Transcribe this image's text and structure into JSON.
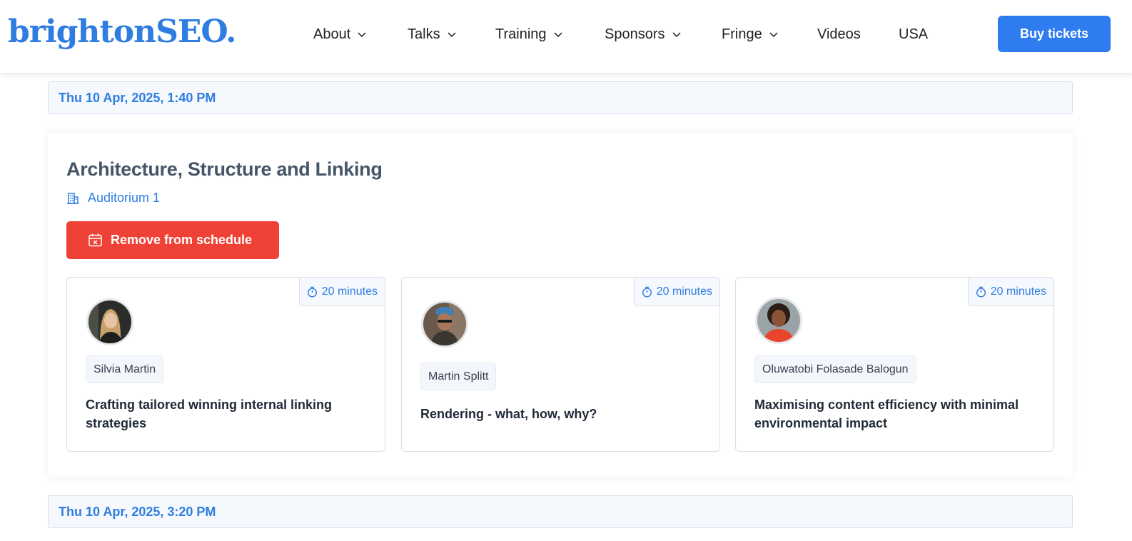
{
  "header": {
    "logo": "brightonSEO.",
    "nav": [
      {
        "label": "About",
        "dropdown": true
      },
      {
        "label": "Talks",
        "dropdown": true
      },
      {
        "label": "Training",
        "dropdown": true
      },
      {
        "label": "Sponsors",
        "dropdown": true
      },
      {
        "label": "Fringe",
        "dropdown": true
      },
      {
        "label": "Videos",
        "dropdown": false
      },
      {
        "label": "USA",
        "dropdown": false
      }
    ],
    "buy_label": "Buy tickets"
  },
  "timeslots": [
    {
      "label": "Thu 10 Apr, 2025, 1:40 PM"
    },
    {
      "label": "Thu 10 Apr, 2025, 3:20 PM"
    }
  ],
  "session": {
    "title": "Architecture, Structure and Linking",
    "room": "Auditorium 1",
    "room_icon": "building-icon",
    "remove_label": "Remove from schedule",
    "remove_icon": "calendar-x-icon",
    "talks": [
      {
        "duration": "20 minutes",
        "speaker": "Silvia Martin",
        "title_lines": [
          "Crafting tailored winning internal linking",
          "strategies"
        ]
      },
      {
        "duration": "20 minutes",
        "speaker": "Martin Splitt",
        "title_lines": [
          "Rendering - what, how, why?"
        ]
      },
      {
        "duration": "20 minutes",
        "speaker": "Oluwatobi Folasade Balogun",
        "title_lines": [
          "Maximising content efficiency with minimal",
          "environmental impact"
        ]
      }
    ]
  },
  "colors": {
    "brand": "#2f7de1",
    "buy_button": "#2f7cf0",
    "remove_button": "#ef4136",
    "title": "#475569"
  }
}
